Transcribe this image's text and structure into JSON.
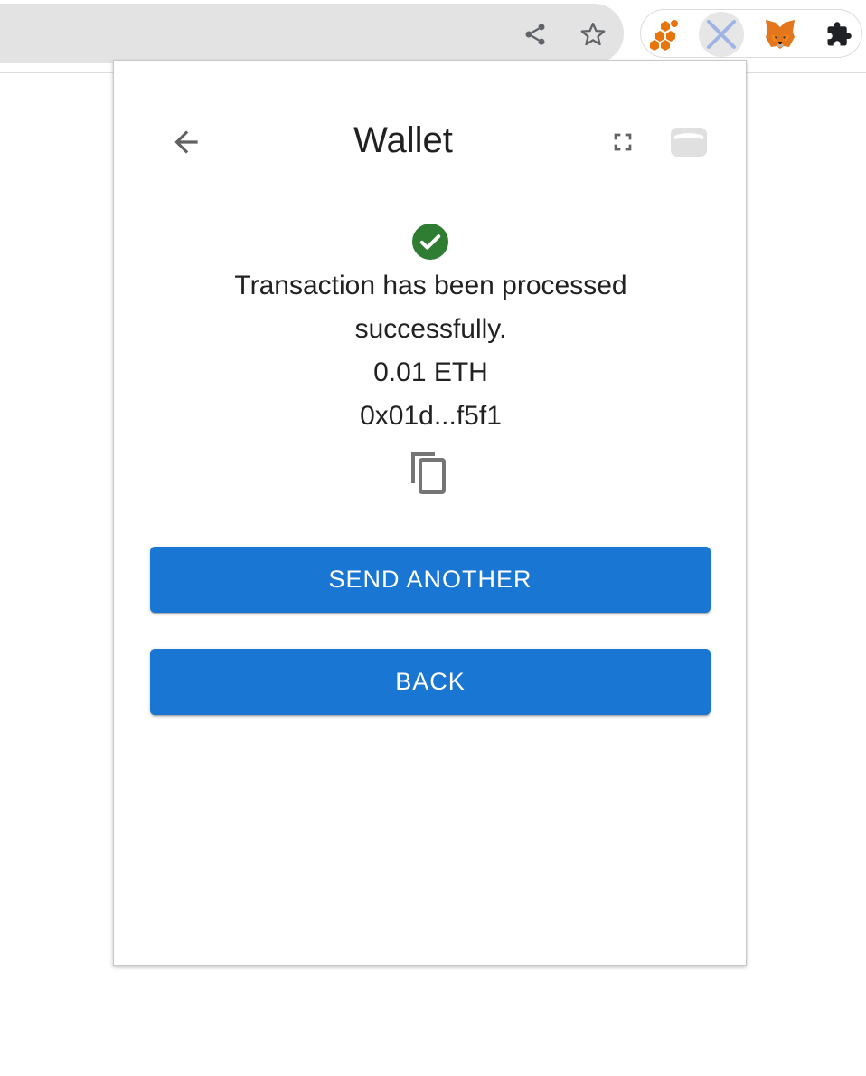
{
  "browser": {
    "toolbar_icons": [
      "share-icon",
      "star-icon"
    ],
    "extensions": [
      "honeycomb-extension-icon",
      "x-extension-icon",
      "metamask-fox-icon",
      "puzzle-extensions-icon"
    ],
    "colors": {
      "omnibox_bg": "#e3e3e3",
      "honeycomb": "#e8740c",
      "x_icon": "#9fb4e6",
      "fox": "#e2761b"
    }
  },
  "wallet": {
    "title": "Wallet",
    "header_icons": {
      "back": "arrow-left-icon",
      "expand": "fullscreen-icon",
      "wallet": "wallet-card-icon"
    },
    "status_icon": "check-circle-icon",
    "message_line1": "Transaction has been processed",
    "message_line2": "successfully.",
    "amount": "0.01 ETH",
    "tx_hash": "0x01d...f5f1",
    "copy_icon": "copy-icon",
    "send_another_label": "SEND ANOTHER",
    "back_label": "BACK",
    "colors": {
      "primary": "#1976d2",
      "success": "#2e7d32",
      "icon_gray": "#757575"
    }
  }
}
